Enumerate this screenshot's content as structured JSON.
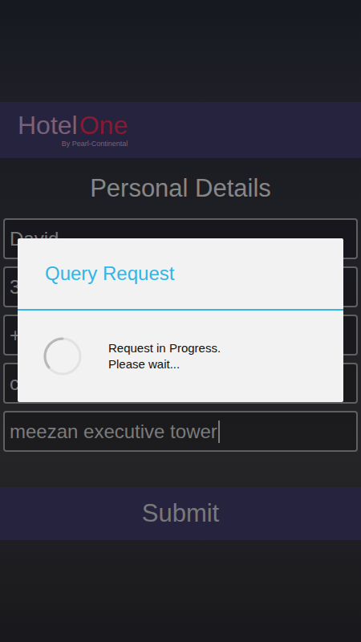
{
  "app": {
    "logo": {
      "word": "Hotel",
      "brand": "One",
      "tagline": "By Pearl-Continental"
    }
  },
  "form": {
    "title": "Personal Details",
    "fields": [
      {
        "value": "David",
        "focused": false
      },
      {
        "value": "3",
        "focused": false
      },
      {
        "value": "+",
        "focused": false
      },
      {
        "value": "c",
        "focused": false
      },
      {
        "value": "meezan executive tower",
        "focused": true
      }
    ],
    "submit": "Submit"
  },
  "dialog": {
    "title": "Query Request",
    "message": [
      "Request in Progress.",
      "Please wait..."
    ],
    "busy": true
  }
}
